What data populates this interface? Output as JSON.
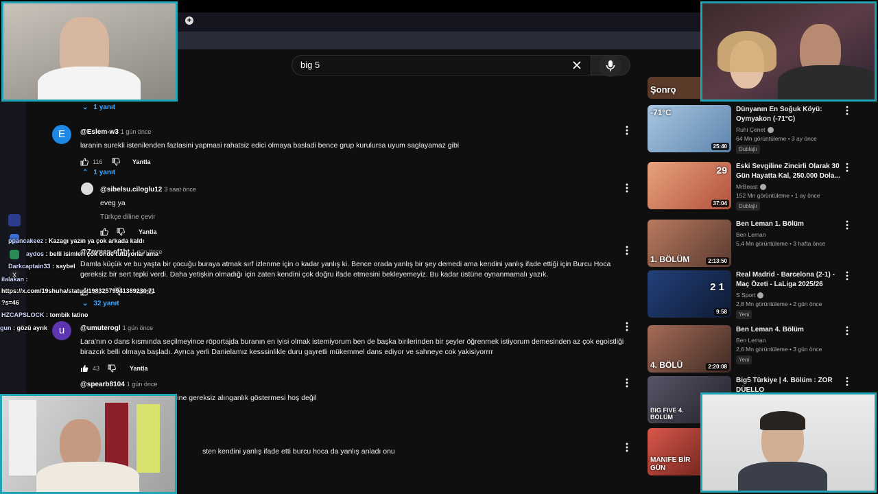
{
  "search": {
    "query": "big 5"
  },
  "comments": [
    {
      "author": "@Eslem-w3",
      "time": "1 gün önce",
      "avatar_letter": "E",
      "avatar_color": "#1e88e5",
      "text": "laranin surekli istenilenden fazlasini yapmasi rahatsiz edici olmaya basladi bence grup kurulursa uyum saglayamaz gibi",
      "likes": "116",
      "reply_label": "Yantla"
    },
    {
      "author": "@sibelsu.ciloglu12",
      "time": "3 saat önce",
      "text": "eveg ya",
      "translate": "Türkçe diline çevir",
      "reply_label": "Yantla"
    },
    {
      "author": "@Zeynep-ef1ht",
      "time": "1 gün önce",
      "text": "Damla küçük ve bu yaşta bir çocuğu buraya atmak sırf izlenme için o kadar yanlış ki. Bence orada yanlış bir şey demedi ama kendini yanlış ifade ettiği için Burcu Hoca gereksiz bir sert tepki verdi. Daha yetişkin olmadığı için zaten kendini çok doğru ifade etmesini bekleyemeyiz. Bu kadar üstüne oynanmamalı yazık.",
      "likes": "1,3 B",
      "reply_label": "Yantla"
    },
    {
      "author": "@umuterogl",
      "time": "1 gün önce",
      "avatar_letter": "u",
      "avatar_color": "#5e35b1",
      "text": "Lara'nın o dans kısmında seçilmeyince röportajda buranın en iyisi olmak istemiyorum ben de başka birilerinden bir şeyler öğrenmek istiyorum demesinden az çok egoistliği birazcık belli olmaya başladı. Ayrıca yerli Danielamız kesssinlikle duru gayretli mükemmel dans ediyor ve sahneye cok yakisiyorrrr",
      "likes": "43",
      "reply_label": "Yantla"
    },
    {
      "author": "@spearb8104",
      "time": "1 gün önce",
      "text": "burcu hocanın damlanın dediğine gereksiz alınganlık göstermesi hoş değil"
    },
    {
      "text": "sten kendini yanlış ifade etti burcu hoca da yanlış anladı onu"
    }
  ],
  "replies_toggles": [
    {
      "label": "1 yanıt",
      "expanded": false
    },
    {
      "label": "1 yanıt",
      "expanded": true
    },
    {
      "label": "32 yanıt",
      "expanded": false
    }
  ],
  "videos": [
    {
      "title": "Dünyanın En Soğuk Köyü: Oymyakon (-71°C)",
      "channel": "Ruhi Çenet",
      "meta": "64 Mn görüntüleme • 3 ay önce",
      "badge": "Dublajlı",
      "duration": "25:40",
      "thumb_text": "-71°C",
      "thumb_color": "#7fa6c8"
    },
    {
      "title": "Eski Sevgiline Zincirli Olarak 30 Gün Hayatta Kal, 250.000 Dola...",
      "channel": "MrBeast",
      "meta": "152 Mn görüntüleme • 1 ay önce",
      "badge": "Dublajlı",
      "duration": "37:04",
      "thumb_text": "29",
      "thumb_color": "#c96c4f"
    },
    {
      "title": "Ben Leman 1. Bölüm",
      "channel": "Ben Leman",
      "meta": "5,4 Mn görüntüleme • 3 hafta önce",
      "duration": "2:13:50",
      "thumb_text": "1. BÖLÜM",
      "thumb_color": "#8a5a46"
    },
    {
      "title": "Real Madrid - Barcelona (2-1) - Maç Özeti - LaLiga 2025/26",
      "channel": "S Sport",
      "meta": "2,8 Mn görüntüleme • 2 gün önce",
      "badge": "Yeni",
      "duration": "9:58",
      "thumb_text": "2  1",
      "thumb_color": "#1b2f5c"
    },
    {
      "title": "Ben Leman 4. Bölüm",
      "channel": "Ben Leman",
      "meta": "2,6 Mn görüntüleme • 3 gün önce",
      "badge": "Yeni",
      "duration": "2:20:08",
      "thumb_text": "4. BÖLÜ",
      "thumb_color": "#6e4c40"
    },
    {
      "title": "Big5 Türkiye | 4. Bölüm : ZOR DÜELLO",
      "thumb_text": "BIG FIVE 4. BÖLÜM",
      "thumb_color": "#3b3b48"
    },
    {
      "thumb_text": "MANIFE BİR GÜN",
      "thumb_color": "#b0392f"
    }
  ],
  "chat": [
    {
      "user": "ppancakeez",
      "message": "Kazagı yazın ya çok arkada kaldı"
    },
    {
      "user": "aydos",
      "message": "belli isimleri çok önde tutuyorlar ama"
    },
    {
      "user": "Darkcaptain33",
      "message": "saybel"
    },
    {
      "user": "ilalakan",
      "message": ""
    },
    {
      "user": "",
      "message": "https://x.com/19shuha/status/19832579941389230 71"
    },
    {
      "user": "",
      "message": "?s=46"
    },
    {
      "user": "HZCAPSLOCK",
      "message": "tombik latino"
    },
    {
      "user": "gun",
      "message": "gözü ayrık"
    }
  ],
  "sidebar_preview_text": "Şonrǫ",
  "colors": {
    "background": "#0f0f0f",
    "link": "#3ea6ff",
    "cam_border": "#1fa4b6"
  }
}
